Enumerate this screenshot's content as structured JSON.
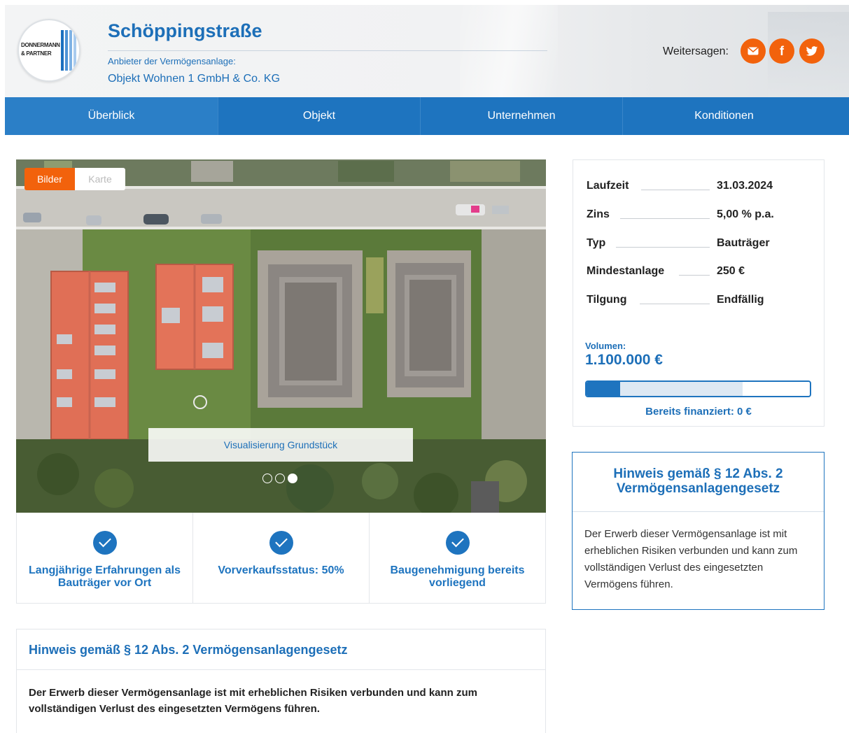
{
  "header": {
    "title": "Schöppingstraße",
    "provider_label": "Anbieter der Vermögensanlage:",
    "provider_name": "Objekt Wohnen 1 GmbH & Co. KG",
    "logo_text_line1": "DONNERMANN",
    "logo_text_line2": "& PARTNER",
    "share_label": "Weitersagen:",
    "social_icons": [
      "mail-icon",
      "facebook-icon",
      "twitter-icon"
    ],
    "social_color": "#f2620c"
  },
  "nav": {
    "items": [
      "Überblick",
      "Objekt",
      "Unternehmen",
      "Konditionen"
    ],
    "active": "Überblick",
    "color": "#1e74bf"
  },
  "gallery": {
    "tabs": [
      "Bilder",
      "Karte"
    ],
    "active_tab": "Bilder",
    "caption": "Visualisierung Grundstück",
    "slide_count": 3,
    "active_slide": 3
  },
  "features": [
    {
      "text": "Langjährige Erfahrungen als Bauträger vor Ort"
    },
    {
      "text": "Vorverkaufsstatus: 50%"
    },
    {
      "text": "Baugenehmigung bereits vorliegend"
    }
  ],
  "terms": {
    "rows": [
      {
        "label": "Laufzeit",
        "value": "31.03.2024"
      },
      {
        "label": "Zins",
        "value": "5,00 % p.a."
      },
      {
        "label": "Typ",
        "value": "Bauträger"
      },
      {
        "label": "Mindestanlage",
        "value": "250 €"
      },
      {
        "label": "Tilgung",
        "value": "Endfällig"
      }
    ],
    "volume_label": "Volumen:",
    "volume_value": "1.100.000 €",
    "progress_fraction": 0.15,
    "financed_text": "Bereits finanziert: 0 €"
  },
  "notice_side": {
    "title": "Hinweis gemäß § 12 Abs. 2 Vermögensanlagengesetz",
    "body": "Der Erwerb dieser Vermögensanlage ist mit erheblichen Risiken verbunden und kann zum vollständigen Verlust des eingesetzten Vermögens führen."
  },
  "notice_wide": {
    "title": "Hinweis gemäß § 12 Abs. 2 Vermögensanlagengesetz",
    "body": "Der Erwerb dieser Vermögensanlage ist mit erheblichen Risiken verbunden und kann zum vollständigen Verlust des eingesetzten Vermögens führen."
  }
}
